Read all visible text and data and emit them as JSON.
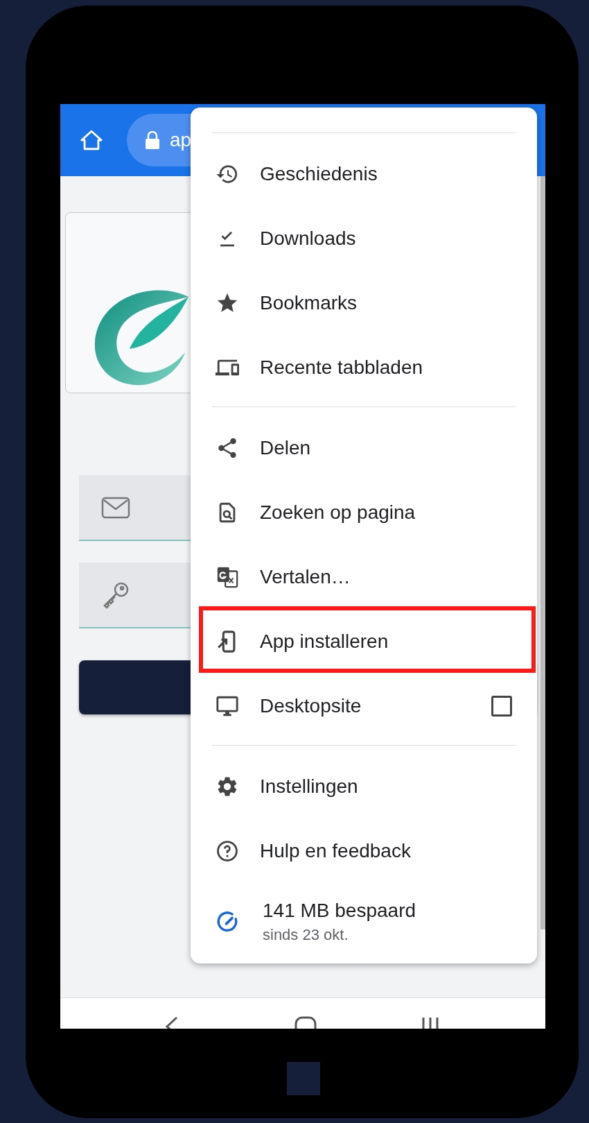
{
  "browser": {
    "url_text": "ap"
  },
  "page": {
    "fields": [
      {
        "kind": "email"
      },
      {
        "kind": "password"
      }
    ]
  },
  "menu": {
    "groups": [
      {
        "items": [
          {
            "kind": "history",
            "label": "Geschiedenis",
            "highlighted": false
          },
          {
            "kind": "downloads",
            "label": "Downloads",
            "highlighted": false
          },
          {
            "kind": "bookmarks",
            "label": "Bookmarks",
            "highlighted": false
          },
          {
            "kind": "devices",
            "label": "Recente tabbladen",
            "highlighted": false
          }
        ]
      },
      {
        "items": [
          {
            "kind": "share",
            "label": "Delen",
            "highlighted": false
          },
          {
            "kind": "find",
            "label": "Zoeken op pagina",
            "highlighted": false
          },
          {
            "kind": "translate",
            "label": "Vertalen…",
            "highlighted": false
          },
          {
            "kind": "install",
            "label": "App installeren",
            "highlighted": true
          },
          {
            "kind": "desktop",
            "label": "Desktopsite",
            "highlighted": false,
            "checked": false
          }
        ]
      },
      {
        "items": [
          {
            "kind": "settings",
            "label": "Instellingen",
            "highlighted": false
          },
          {
            "kind": "help",
            "label": "Hulp en feedback",
            "highlighted": false
          }
        ]
      }
    ],
    "data_saver": {
      "title": "141 MB bespaard",
      "subtitle": "sinds 23 okt."
    }
  }
}
